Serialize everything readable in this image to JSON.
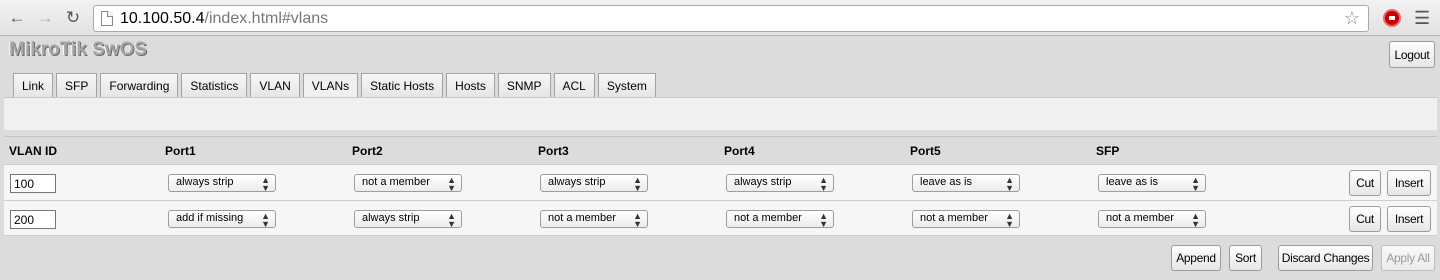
{
  "browser": {
    "url_host": "10.100.50.4",
    "url_path": "/index.html#vlans"
  },
  "app": {
    "brand": "MikroTik SwOS",
    "logout_label": "Logout",
    "tabs": [
      {
        "label": "Link",
        "active": false
      },
      {
        "label": "SFP",
        "active": false
      },
      {
        "label": "Forwarding",
        "active": false
      },
      {
        "label": "Statistics",
        "active": false
      },
      {
        "label": "VLAN",
        "active": false
      },
      {
        "label": "VLANs",
        "active": true
      },
      {
        "label": "Static Hosts",
        "active": false
      },
      {
        "label": "Hosts",
        "active": false
      },
      {
        "label": "SNMP",
        "active": false
      },
      {
        "label": "ACL",
        "active": false
      },
      {
        "label": "System",
        "active": false
      }
    ]
  },
  "table": {
    "headers": [
      "VLAN ID",
      "Port1",
      "Port2",
      "Port3",
      "Port4",
      "Port5",
      "SFP"
    ],
    "rows": [
      {
        "vlan_id": "100",
        "ports": [
          "always strip",
          "not a member",
          "always strip",
          "always strip",
          "leave as is",
          "leave as is"
        ]
      },
      {
        "vlan_id": "200",
        "ports": [
          "add if missing",
          "always strip",
          "not a member",
          "not a member",
          "not a member",
          "not a member"
        ]
      }
    ],
    "cut_label": "Cut",
    "insert_label": "Insert"
  },
  "actions": {
    "append": "Append",
    "sort": "Sort",
    "discard": "Discard Changes",
    "apply": "Apply All"
  }
}
